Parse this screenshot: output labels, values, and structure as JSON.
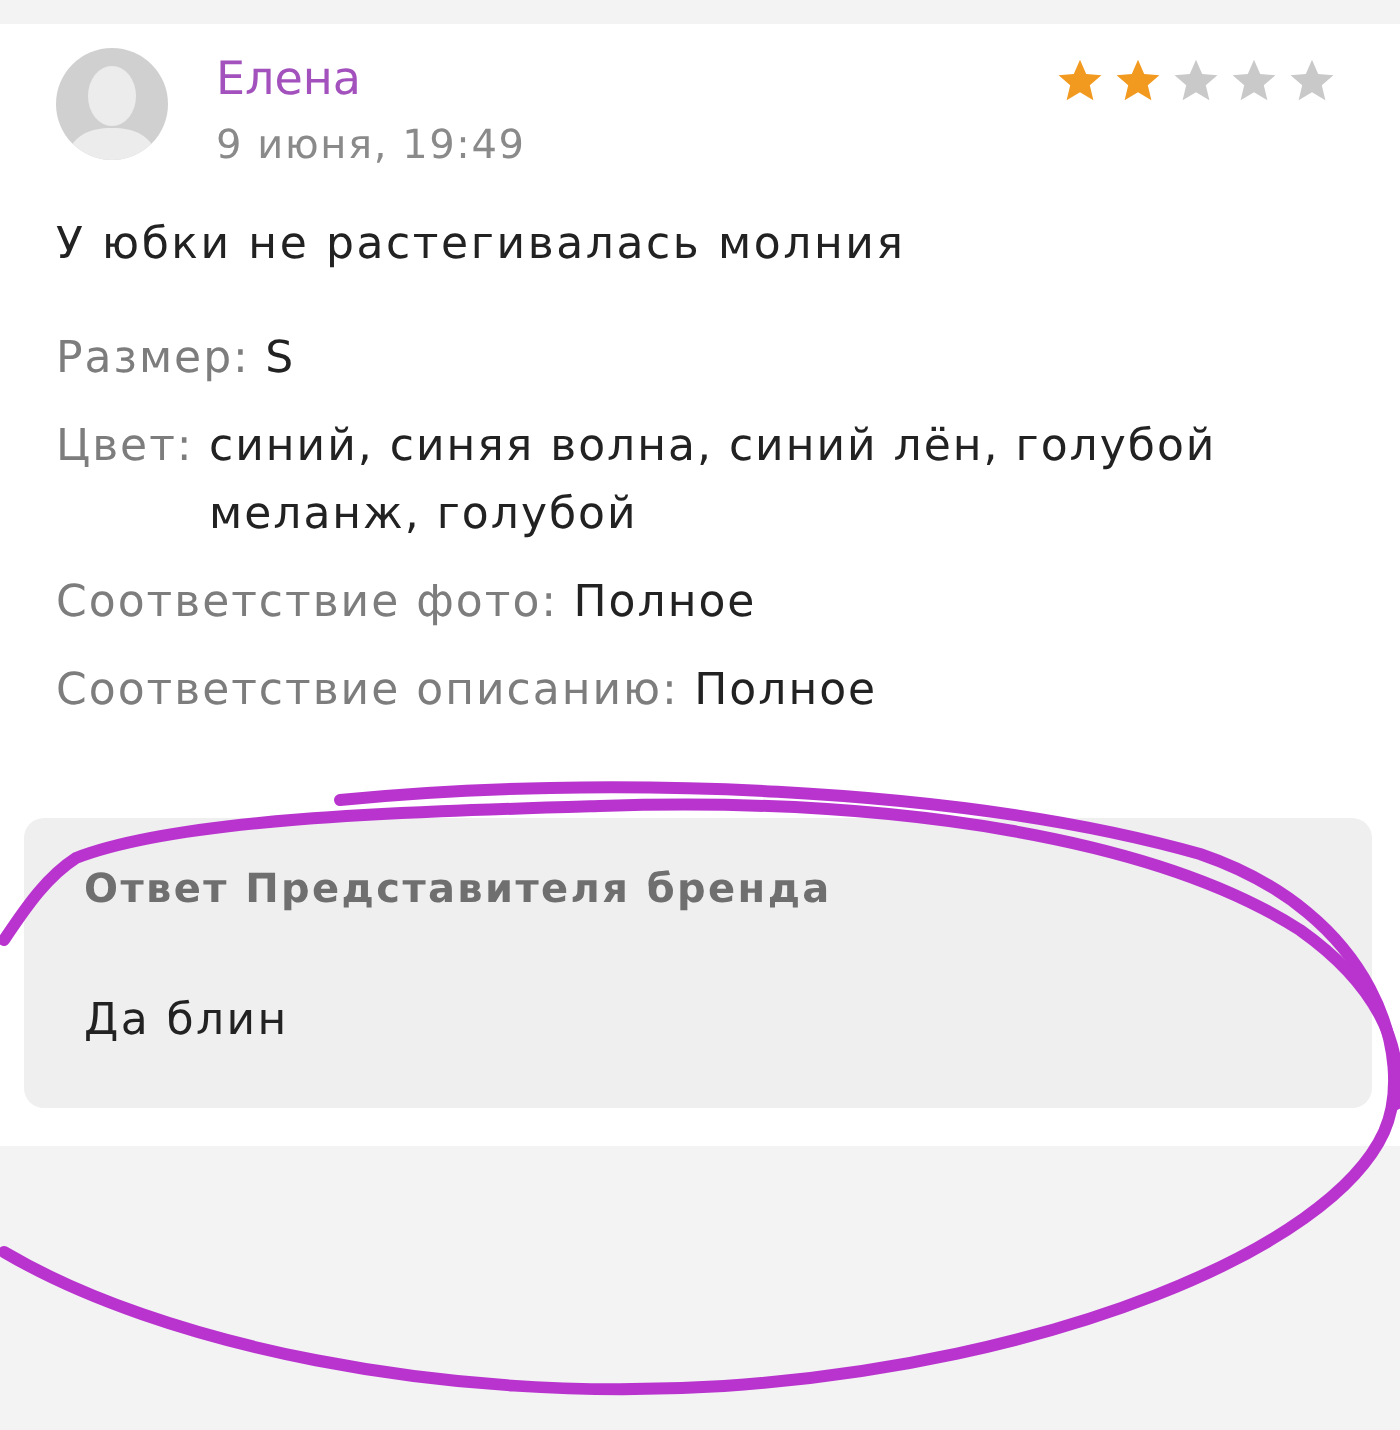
{
  "review": {
    "author": "Елена",
    "date": "9 июня, 19:49",
    "stars": 2,
    "text": "У юбки не растегивалась молния",
    "details": [
      {
        "label": "Размер:",
        "value": "S"
      },
      {
        "label": "Цвет:",
        "value": "синий, синяя волна, синий лён, голубой меланж, голубой"
      },
      {
        "label": "Соответствие фото:",
        "value": "Полное"
      },
      {
        "label": "Соответствие описанию:",
        "value": "Полное"
      }
    ],
    "brand_reply": {
      "title": "Ответ Представителя бренда",
      "text": "Да блин"
    }
  }
}
